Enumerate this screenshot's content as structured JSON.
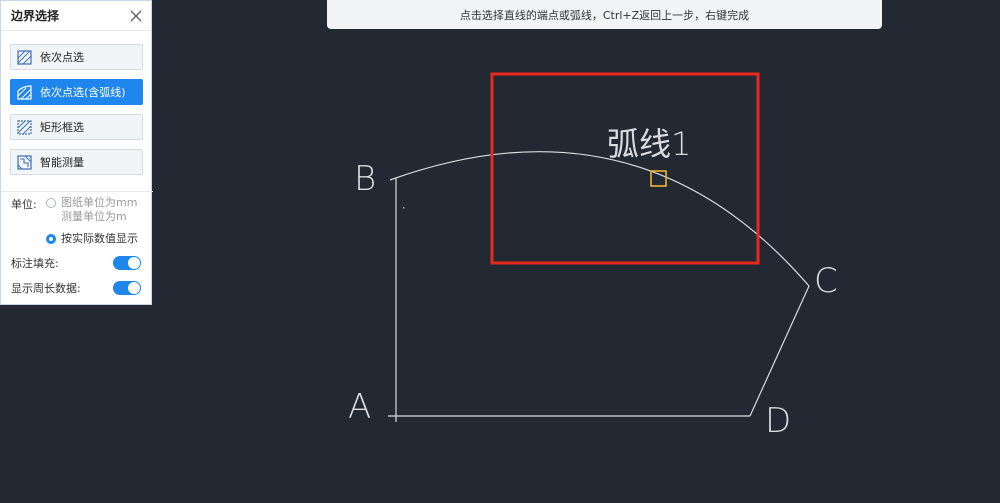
{
  "panel": {
    "title": "边界选择",
    "buttons": [
      {
        "label": "依次点选",
        "icon": "hatch-icon",
        "active": false
      },
      {
        "label": "依次点选(含弧线)",
        "icon": "hatch-arc-icon",
        "active": true
      },
      {
        "label": "矩形框选",
        "icon": "rect-select-icon",
        "active": false
      },
      {
        "label": "智能测量",
        "icon": "smart-measure-icon",
        "active": false
      }
    ],
    "unit_label": "单位:",
    "unit_options": [
      {
        "line1": "图纸单位为mm",
        "line2": "测量单位为m",
        "checked": false
      },
      {
        "line1": "按实际数值显示",
        "checked": true
      }
    ],
    "toggles": [
      {
        "label": "标注填充:",
        "on": true
      },
      {
        "label": "显示周长数据:",
        "on": true
      }
    ]
  },
  "hint": "点击选择直线的端点或弧线，Ctrl+Z返回上一步，右键完成",
  "drawing": {
    "arc_label": "弧线1",
    "points": {
      "A": "A",
      "B": "B",
      "C": "C",
      "D": "D"
    }
  },
  "colors": {
    "canvas_bg": "#232932",
    "line": "#d9dde2",
    "selection_rect": "#e8281f",
    "snap_marker": "#f2b233",
    "accent": "#1e86ec"
  }
}
